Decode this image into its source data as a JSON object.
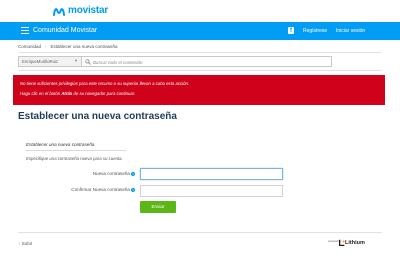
{
  "brand": {
    "name": "movistar",
    "color": "#019df4"
  },
  "nav": {
    "title": "Comunidad Movistar",
    "register": "Regístrese",
    "login": "Iniciar sesión",
    "bg_color": "#019df4"
  },
  "breadcrumb": {
    "items": [
      "Comunidad",
      "Establecer una nueva contraseña"
    ]
  },
  "search": {
    "scope": "EnriqueMurilloRuiz",
    "placeholder": "Buscar todo el contenido"
  },
  "alert": {
    "line1": "No tiene suficientes privilegios para este recurso o su superior llevan a cabo esta acción.",
    "line2_prefix": "Haga clic en el botón ",
    "line2_bold": "Atrás",
    "line2_suffix": " de su navegador para continuar.",
    "bg_color": "#d0021b"
  },
  "page": {
    "title": "Establecer una nueva contraseña"
  },
  "form": {
    "section_title": "Establecer una nueva contraseña",
    "description": "Especifique una contraseña nueva para su cuenta.",
    "new_password_label": "Nueva contraseña",
    "confirm_password_label": "Confirmar Nueva contraseña",
    "new_password_value": "",
    "confirm_password_value": "",
    "submit_label": "Enviar",
    "submit_color": "#5cb615"
  },
  "footer": {
    "back_to_top": "Subir",
    "powered_by": "powered by",
    "vendor": "Lithium"
  }
}
